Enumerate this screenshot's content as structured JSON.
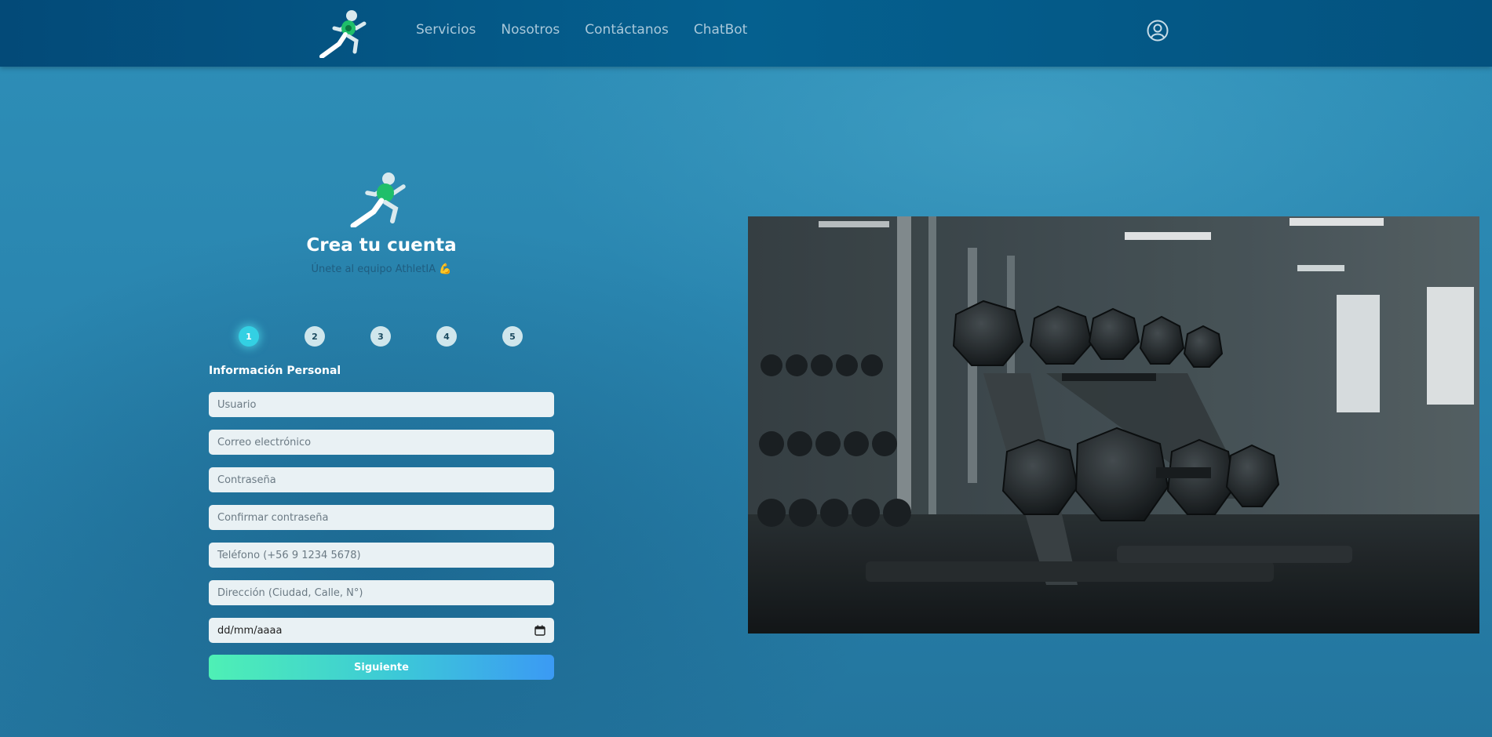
{
  "nav": {
    "links": [
      "Servicios",
      "Nosotros",
      "Contáctanos",
      "ChatBot"
    ]
  },
  "form": {
    "title": "Crea tu cuenta",
    "subtitle": "Únete al equipo AthletIA 💪",
    "steps": [
      "1",
      "2",
      "3",
      "4",
      "5"
    ],
    "active_step": 1,
    "section_title": "Información Personal",
    "fields": {
      "username": "Usuario",
      "email": "Correo electrónico",
      "password": "Contraseña",
      "confirm_password": "Confirmar contraseña",
      "phone": "Teléfono (+56 9 1234 5678)",
      "address": "Dirección (Ciudad, Calle, N°)",
      "birthdate": "dd/mm/aaaa"
    },
    "next_label": "Siguiente"
  },
  "icons": {
    "logo": "running-man-icon",
    "user": "user-circle-icon",
    "calendar": "calendar-icon"
  },
  "colors": {
    "accent_start": "#4ef0b5",
    "accent_end": "#3b9af4",
    "active_step": "#33d0e3"
  }
}
